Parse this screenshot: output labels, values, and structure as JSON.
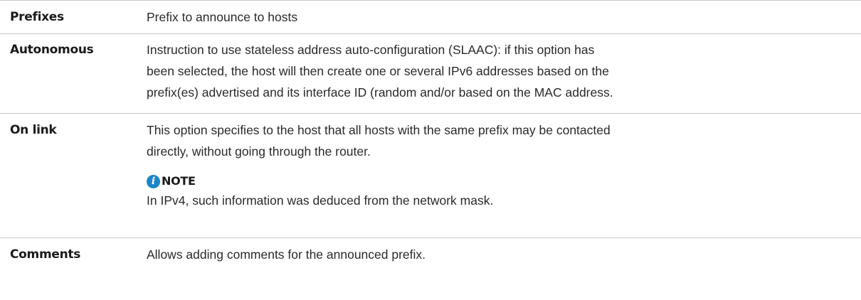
{
  "rows": [
    {
      "term": "Prefixes",
      "definition": "Prefix to announce to hosts"
    },
    {
      "term": "Autonomous",
      "definition_lines": [
        "Instruction to use stateless address auto-configuration (SLAAC): if this option has",
        "been selected, the host will then create one or several IPv6 addresses based on the",
        "prefix(es) advertised and its interface ID (random and/or based on the MAC address."
      ]
    },
    {
      "term": "On link",
      "definition_lines": [
        "This option specifies to the host that all hosts with the same prefix may be contacted",
        "directly, without going through the router."
      ],
      "note": {
        "icon": "info-icon",
        "icon_glyph": "i",
        "title": "NOTE",
        "text": "In IPv4, such information was deduced from the network mask."
      }
    },
    {
      "term": "Comments",
      "definition": "Allows adding comments for the announced prefix."
    }
  ],
  "colors": {
    "rule": "#c8c8c8",
    "info_icon": "#1b85c7",
    "text": "#2a2a2a"
  }
}
